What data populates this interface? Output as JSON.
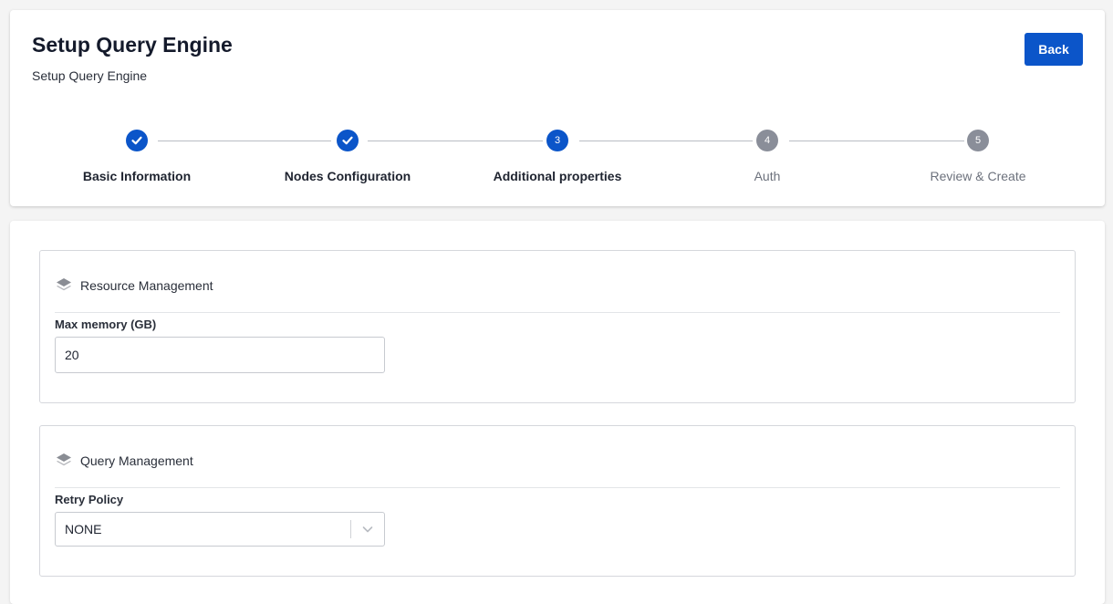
{
  "header": {
    "title": "Setup Query Engine",
    "subtitle": "Setup Query Engine",
    "back_label": "Back"
  },
  "stepper": {
    "steps": [
      {
        "number": "1",
        "label": "Basic Information",
        "state": "done"
      },
      {
        "number": "2",
        "label": "Nodes Configuration",
        "state": "done"
      },
      {
        "number": "3",
        "label": "Additional properties",
        "state": "active"
      },
      {
        "number": "4",
        "label": "Auth",
        "state": "pending"
      },
      {
        "number": "5",
        "label": "Review & Create",
        "state": "pending"
      }
    ]
  },
  "sections": {
    "resource": {
      "icon": "layers-icon",
      "title": "Resource Management",
      "field_label": "Max memory (GB)",
      "field_value": "20"
    },
    "query": {
      "icon": "layers-icon",
      "title": "Query Management",
      "field_label": "Retry Policy",
      "selected_value": "NONE"
    }
  },
  "colors": {
    "accent": "#0b55c9",
    "pending": "#8a8e99"
  }
}
